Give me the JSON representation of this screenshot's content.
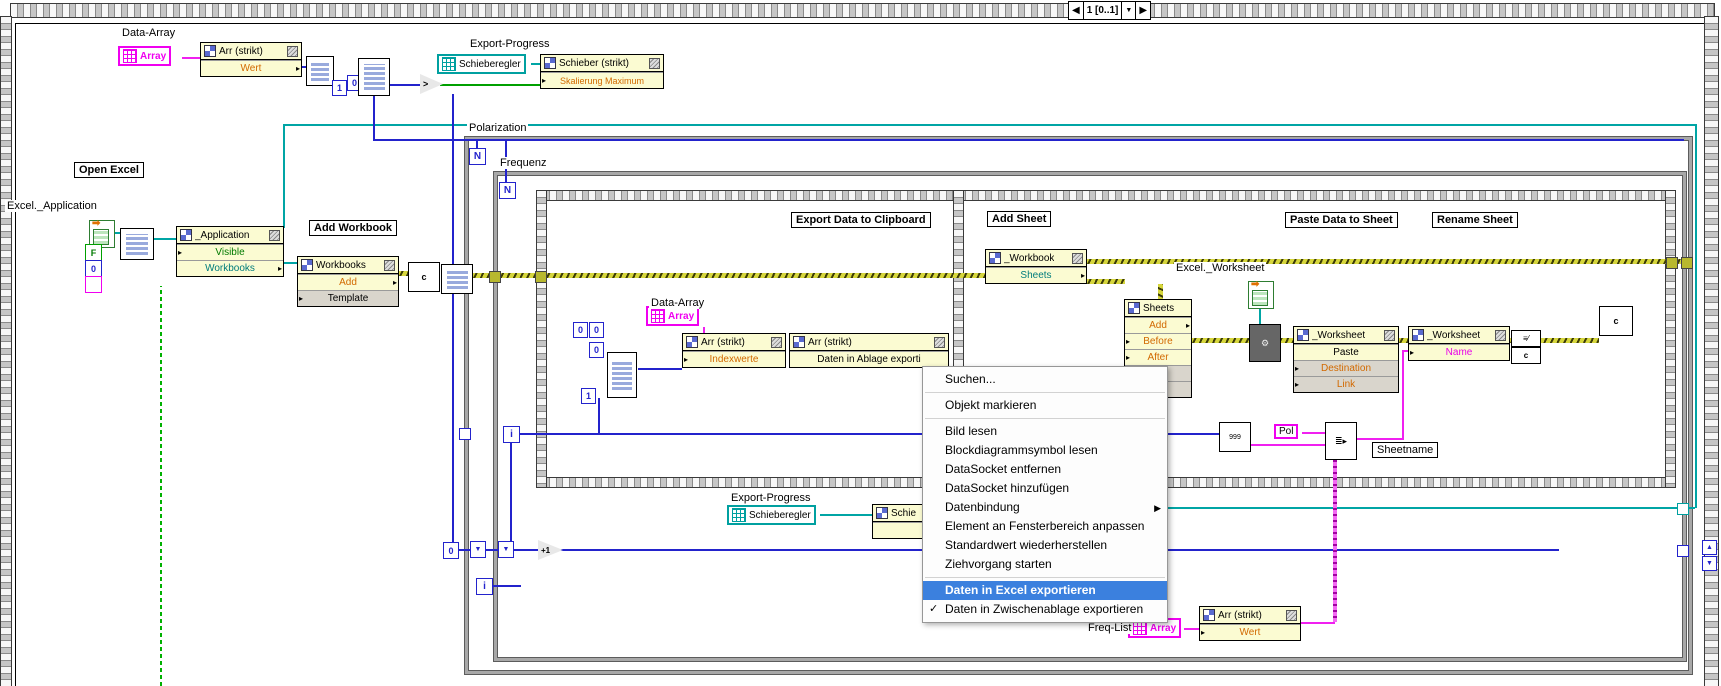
{
  "selector": {
    "label": "1 [0..1]",
    "left_arrow": "◀",
    "right_arrow": "▶",
    "drop_arrow": "▼"
  },
  "labels": {
    "data_array_top": "Data-Array",
    "export_progress_top": "Export-Progress",
    "open_excel": "Open Excel",
    "excel_application": "Excel._Application",
    "add_workbook": "Add Workbook",
    "polarization": "Polarization",
    "frequenz": "Frequenz",
    "export_data_clipboard": "Export Data to Clipboard",
    "data_array_inner": "Data-Array",
    "add_sheet": "Add Sheet",
    "excel_worksheet": "Excel._Worksheet",
    "paste_data_sheet": "Paste Data to Sheet",
    "rename_sheet": "Rename Sheet",
    "sheetname": "Sheetname",
    "export_progress_inner": "Export-Progress",
    "freq_list": "Freq-List"
  },
  "terminals": {
    "array": "Array",
    "schieberegler": "Schieberegler",
    "pol": "Pol"
  },
  "consts": {
    "zero": "0",
    "one": "1",
    "f": "F",
    "n": "N",
    "i": "i",
    "plus_one": "+1",
    "gt": ">",
    "c": "c"
  },
  "nodes": {
    "arr_wert_top": {
      "header": "Arr (strikt)",
      "row1": "Wert"
    },
    "schieber_strikt": {
      "header": "Schieber (strikt)",
      "row1": "Skalierung Maximum"
    },
    "application": {
      "header": "_Application",
      "row1": "Visible",
      "row2": "Workbooks"
    },
    "workbooks": {
      "header": "Workbooks",
      "row1": "Add",
      "row2": "Template"
    },
    "arr_indexwerte": {
      "header": "Arr (strikt)",
      "row1": "Indexwerte"
    },
    "arr_ablage": {
      "header": "Arr (strikt)",
      "row1": "Daten in Ablage exporti"
    },
    "workbook": {
      "header": "_Workbook",
      "row1": "Sheets"
    },
    "sheets": {
      "header": "Sheets",
      "row1": "Add",
      "row2": "Before",
      "row3": "After"
    },
    "worksheet_invoke": {
      "header": "_Worksheet",
      "row1": "Paste",
      "row2": "Destination",
      "row3": "Link"
    },
    "worksheet_property": {
      "header": "_Worksheet",
      "row1": "Name"
    },
    "schie_partial": {
      "header": "Schie"
    },
    "arr_wert_bottom": {
      "header": "Arr (strikt)",
      "row1": "Wert"
    }
  },
  "menu": {
    "check_glyph": "✓",
    "submenu_glyph": "▶",
    "items": [
      {
        "label": "Suchen..."
      },
      {
        "label": "Objekt markieren"
      },
      {
        "label": "Bild lesen"
      },
      {
        "label": "Blockdiagrammsymbol lesen"
      },
      {
        "label": "DataSocket entfernen"
      },
      {
        "label": "DataSocket hinzufügen"
      },
      {
        "label": "Datenbindung"
      },
      {
        "label": "Element an Fensterbereich anpassen"
      },
      {
        "label": "Standardwert wiederherstellen"
      },
      {
        "label": "Ziehvorgang starten"
      },
      {
        "label": "Daten in Excel exportieren"
      },
      {
        "label": "Daten in Zwischenablage exportieren"
      }
    ]
  }
}
